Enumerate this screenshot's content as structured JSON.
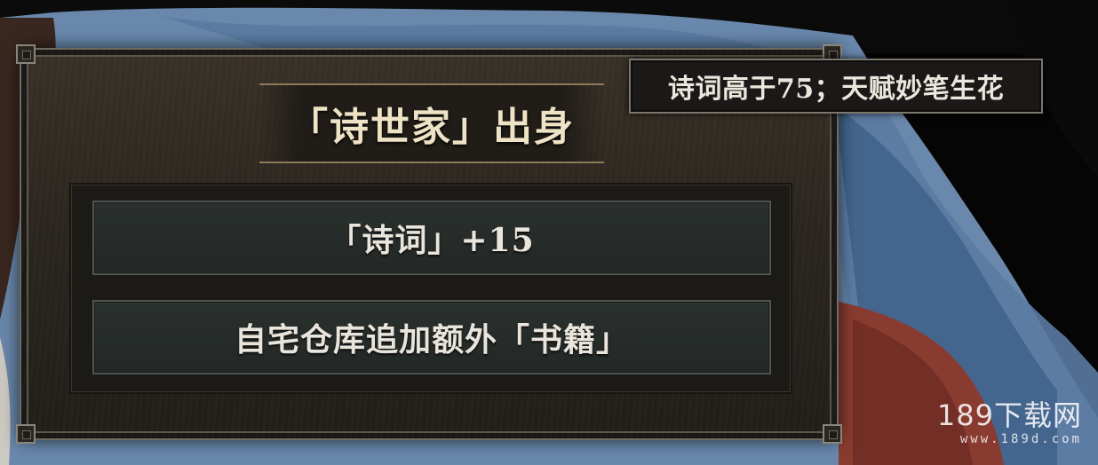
{
  "panel": {
    "title": "「诗世家」出身",
    "effects": [
      {
        "label": "「诗词」+15"
      },
      {
        "label": "自宅仓库追加额外「书籍」"
      }
    ]
  },
  "tooltip": {
    "text": "诗词高于75；天赋妙笔生花"
  },
  "watermark": {
    "main": "189下载网",
    "sub": "www.189d.com"
  },
  "colors": {
    "title_text": "#efe3c6",
    "effect_text": "#e9e5dc",
    "panel_bg": "#2b2620",
    "effect_bg": "#262b29",
    "background_blue": "#5f7da0",
    "background_red": "#8a3b30"
  }
}
